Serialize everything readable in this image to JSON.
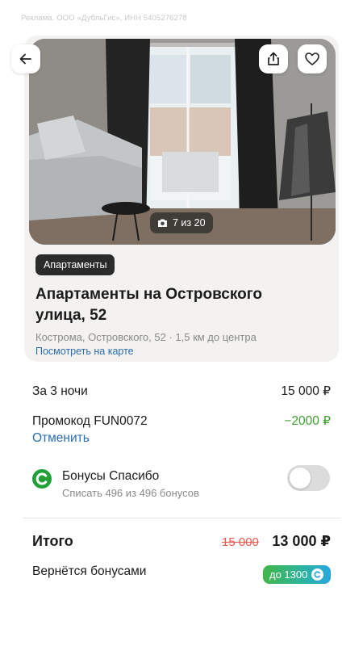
{
  "ad_note": "Реклама. ООО «ДубльГис», ИНН 5405276278",
  "listing": {
    "photo_counter": "7 из 20",
    "tag": "Апартаменты",
    "title": "Апартаменты на Островского улица, 52",
    "address": "Кострома, Островского, 52 · 1,5 км до центра",
    "map_link": "Посмотреть на карте"
  },
  "price": {
    "nights_label": "За 3 ночи",
    "nights_value": "15 000 ₽",
    "promo_label": "Промокод FUN0072",
    "promo_value": "−2000 ₽",
    "cancel_label": "Отменить"
  },
  "bonus": {
    "title": "Бонусы Спасибо",
    "subtitle": "Списать 496 из 496 бонусов",
    "toggle_on": false
  },
  "total": {
    "label": "Итого",
    "old_price": "15 000",
    "new_price": "13 000 ₽"
  },
  "return_bonus": {
    "label": "Вернётся бонусами",
    "pill": "до 1300"
  },
  "icons": {
    "back": "arrow-left-icon",
    "share": "share-icon",
    "favorite": "heart-icon",
    "camera": "camera-icon",
    "sber": "sber-spasibo-icon"
  },
  "colors": {
    "link": "#2b6cb0",
    "discount": "#3f9e2f",
    "old_price": "#e85a4f",
    "sber_green": "#21a038"
  }
}
